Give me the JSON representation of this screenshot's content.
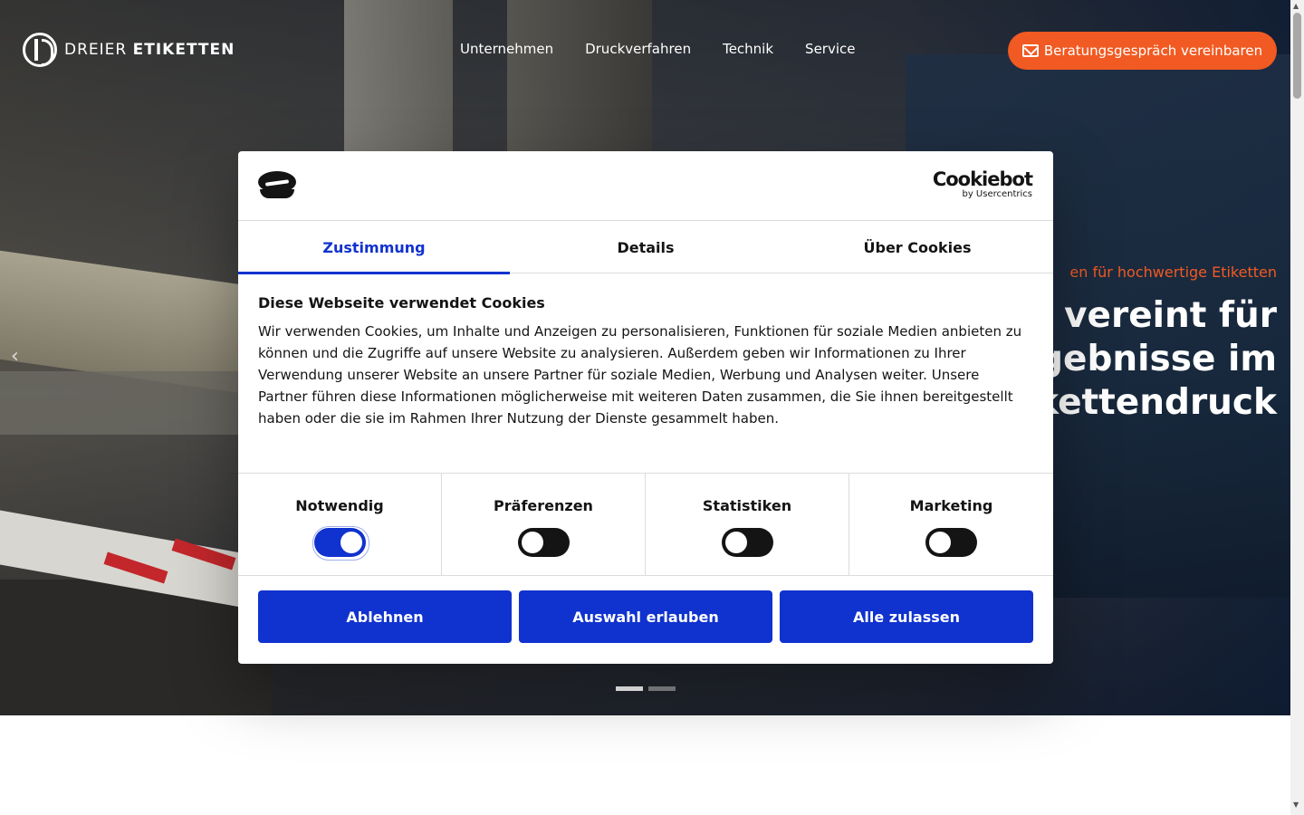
{
  "header": {
    "logo": {
      "light": "DREIER",
      "bold": "ETIKETTEN"
    },
    "menu": [
      "Unternehmen",
      "Druckverfahren",
      "Technik",
      "Service"
    ],
    "cta_label": "Beratungsgespräch vereinbaren"
  },
  "hero": {
    "kicker": "en für hochwertige Etiketten",
    "title_lines": [
      "ik vereint für",
      "rgebnisse im",
      "ikettendruck"
    ],
    "prev_glyph": "‹",
    "slides": 2,
    "active_slide": 1
  },
  "cookie_dialog": {
    "brand_name": "Cookiebot",
    "brand_by": "by Usercentrics",
    "tabs": [
      {
        "label": "Zustimmung",
        "active": true
      },
      {
        "label": "Details",
        "active": false
      },
      {
        "label": "Über Cookies",
        "active": false
      }
    ],
    "title": "Diese Webseite verwendet Cookies",
    "text": "Wir verwenden Cookies, um Inhalte und Anzeigen zu personalisieren, Funktionen für soziale Medien anbieten zu können und die Zugriffe auf unsere Website zu analysieren. Außerdem geben wir Informationen zu Ihrer Verwendung unserer Website an unsere Partner für soziale Medien, Werbung und Analysen weiter. Unsere Partner führen diese Informationen möglicherweise mit weiteren Daten zusammen, die Sie ihnen bereitgestellt haben oder die sie im Rahmen Ihrer Nutzung der Dienste gesammelt haben.",
    "categories": [
      {
        "label": "Notwendig",
        "enabled": true
      },
      {
        "label": "Präferenzen",
        "enabled": false
      },
      {
        "label": "Statistiken",
        "enabled": false
      },
      {
        "label": "Marketing",
        "enabled": false
      }
    ],
    "buttons": {
      "deny": "Ablehnen",
      "allow_selection": "Auswahl erlauben",
      "allow_all": "Alle zulassen"
    }
  },
  "colors": {
    "accent_orange": "#f15a22",
    "cookiebot_blue": "#1032cf"
  }
}
